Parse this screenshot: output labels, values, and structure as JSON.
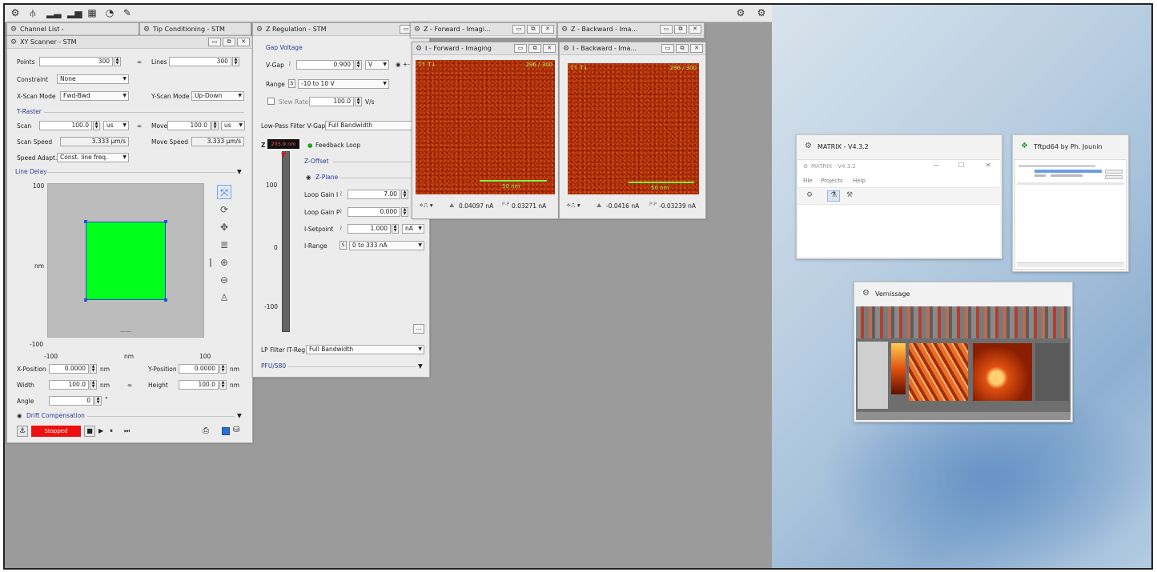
{
  "toolbar": {
    "icons": [
      "gear-icon",
      "antenna-icon",
      "chart-icon",
      "chart2-icon",
      "grid-icon",
      "clock-icon",
      "tool-icon"
    ],
    "right_icons": [
      "gears-icon",
      "gear2-icon"
    ]
  },
  "bg_tabs": [
    {
      "label": "Channel List -"
    },
    {
      "label": "Tip Conditioning - STM"
    }
  ],
  "xy_scanner": {
    "title": "XY Scanner - STM",
    "points_label": "Points",
    "points_value": "300",
    "lines_label": "Lines",
    "lines_value": "300",
    "constraint_label": "Constraint",
    "constraint_value": "None",
    "xscan_label": "X-Scan Mode",
    "xscan_value": "Fwd-Bwd",
    "yscan_label": "Y-Scan Mode",
    "yscan_value": "Up-Down",
    "traster_label": "T-Raster",
    "scan_label": "Scan",
    "scan_value": "100.0",
    "scan_unit": "us",
    "move_label": "Move",
    "move_value": "100.0",
    "move_unit": "us",
    "scan_speed_label": "Scan Speed",
    "scan_speed_value": "3.333 µm/s",
    "move_speed_label": "Move Speed",
    "move_speed_value": "3.333 µm/s",
    "speed_adapt_label": "Speed Adapt.",
    "speed_adapt_value": "Const. line freq.",
    "line_delay_label": "Line Delay",
    "y_axis_top": "100",
    "y_axis_mid": "nm",
    "y_axis_bottom": "-100",
    "x_axis_left": "-100",
    "x_axis_mid": "nm",
    "x_axis_right": "100",
    "xpos_label": "X-Position",
    "xpos_value": "0.0000",
    "xpos_unit": "nm",
    "ypos_label": "Y-Position",
    "ypos_value": "0.0000",
    "ypos_unit": "nm",
    "width_label": "Width",
    "width_value": "100.0",
    "width_unit": "nm",
    "height_label": "Height",
    "height_value": "100.0",
    "height_unit": "nm",
    "angle_label": "Angle",
    "angle_value": "0",
    "angle_unit": "°",
    "drift_label": "Drift Compensation",
    "status_label": "Stopped",
    "scan_color": "#00ff1a"
  },
  "z_regulation": {
    "title": "Z Regulation - STM",
    "gap_voltage_label": "Gap Voltage",
    "vgap_label": "V-Gap",
    "vgap_value": "0.900",
    "vgap_unit": "V",
    "range_label": "Range",
    "range_value": "-10 to 10 V",
    "slew_label": "Slew Rate",
    "slew_value": "100.0",
    "slew_unit": "V/s",
    "lowpass_label": "Low-Pass Filter V-Gap",
    "lowpass_value": "Full Bandwidth",
    "z_label": "Z",
    "z_value": "205.9 nm",
    "feedback_label": "Feedback Loop",
    "zoffset_label": "Z-Offset",
    "zplane_label": "Z-Plane",
    "scale_top": "100",
    "scale_mid": "0",
    "scale_bottom": "-100",
    "loop_i_label": "Loop Gain I",
    "loop_i_value": "7.00",
    "loop_p_label": "Loop Gain P",
    "loop_p_value": "0.000",
    "isetpoint_label": "I-Setpoint",
    "isetpoint_value": "1.000",
    "isetpoint_unit": "nA",
    "irange_label": "I-Range",
    "irange_value": "0 to 333 nA",
    "lp_filter_label": "LP Filter IT-Reg",
    "lp_filter_value": "Full Bandwidth",
    "pfu_label": "PFU/580",
    "more_label": "..."
  },
  "z_forward_tab": {
    "title": "Z - Forward - Imagi..."
  },
  "z_backward_tab": {
    "title": "Z - Backward - Ima..."
  },
  "i_forward": {
    "title": "I - Forward - Imaging",
    "corner_left": "T↑ T↓",
    "corner_right": "296 / 300",
    "scale_label": "50 nm",
    "value1": "0.04097 nA",
    "value2": "0.03271 nA",
    "ptp_label": "P-P"
  },
  "i_backward": {
    "title": "I - Backward - Ima...",
    "corner_left": "T↑ T↓",
    "corner_right": "296 / 300",
    "scale_label": "50 nm",
    "value1": "-0.0416 nA",
    "value2": "-0.03239 nA",
    "ptp_label": "P-P"
  },
  "thumbnails": {
    "matrix": {
      "title": "MATRIX - V4.3.2",
      "inner_title": "MATRIX - V4.3.2",
      "menu": [
        "File",
        "Projects",
        "Help"
      ]
    },
    "tftpd": {
      "title": "Tftpd64 by Ph. Jounin"
    },
    "vernissage": {
      "title": "Vernissage"
    }
  }
}
